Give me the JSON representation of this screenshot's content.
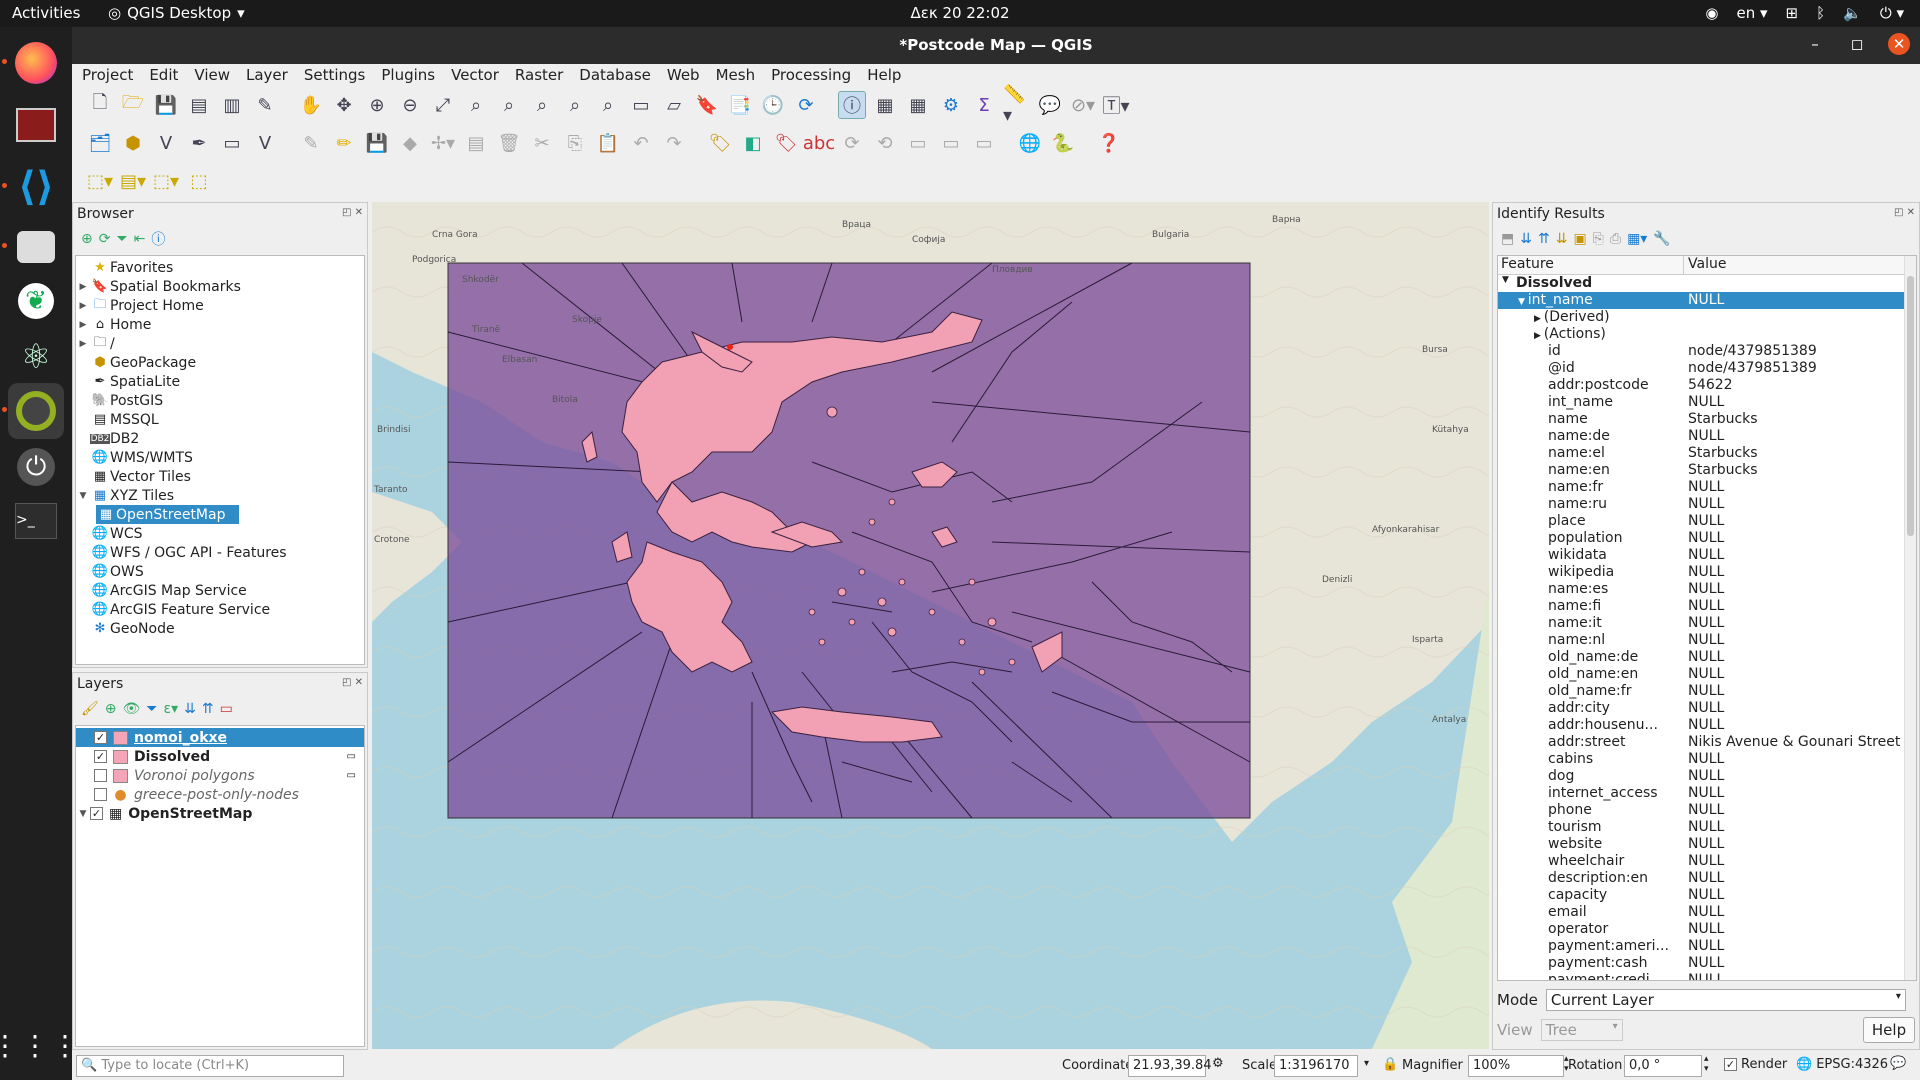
{
  "topbar": {
    "activities": "Activities",
    "app": "QGIS Desktop",
    "clock": "Δεκ 20  22:02",
    "lang": "en"
  },
  "window": {
    "title": "*Postcode Map — QGIS"
  },
  "menu": [
    "Project",
    "Edit",
    "View",
    "Layer",
    "Settings",
    "Plugins",
    "Vector",
    "Raster",
    "Database",
    "Web",
    "Mesh",
    "Processing",
    "Help"
  ],
  "browser": {
    "title": "Browser",
    "items": [
      {
        "label": "Favorites",
        "icon": "star-icon",
        "arrow": ""
      },
      {
        "label": "Spatial Bookmarks",
        "icon": "bookmark-icon",
        "arrow": "▶"
      },
      {
        "label": "Project Home",
        "icon": "folder-icon",
        "arrow": "▶"
      },
      {
        "label": "Home",
        "icon": "home-icon",
        "arrow": "▶"
      },
      {
        "label": "/",
        "icon": "folder-icon",
        "arrow": "▶"
      },
      {
        "label": "GeoPackage",
        "icon": "geopackage-icon",
        "arrow": ""
      },
      {
        "label": "SpatiaLite",
        "icon": "spatialite-icon",
        "arrow": ""
      },
      {
        "label": "PostGIS",
        "icon": "postgis-icon",
        "arrow": ""
      },
      {
        "label": "MSSQL",
        "icon": "mssql-icon",
        "arrow": ""
      },
      {
        "label": "DB2",
        "icon": "db2-icon",
        "arrow": ""
      },
      {
        "label": "WMS/WMTS",
        "icon": "globe-icon",
        "arrow": ""
      },
      {
        "label": "Vector Tiles",
        "icon": "grid-icon",
        "arrow": ""
      },
      {
        "label": "XYZ Tiles",
        "icon": "grid-icon",
        "arrow": "▼"
      },
      {
        "label": "OpenStreetMap",
        "icon": "grid-icon",
        "arrow": "",
        "child": true,
        "selected": true
      },
      {
        "label": "WCS",
        "icon": "globe-icon",
        "arrow": ""
      },
      {
        "label": "WFS / OGC API - Features",
        "icon": "globe-icon",
        "arrow": ""
      },
      {
        "label": "OWS",
        "icon": "globe-icon",
        "arrow": ""
      },
      {
        "label": "ArcGIS Map Service",
        "icon": "globe-icon",
        "arrow": ""
      },
      {
        "label": "ArcGIS Feature Service",
        "icon": "globe-icon",
        "arrow": ""
      },
      {
        "label": "GeoNode",
        "icon": "geonode-icon",
        "arrow": ""
      }
    ]
  },
  "layers": {
    "title": "Layers",
    "items": [
      {
        "label": "nomoi_okxe",
        "checked": true,
        "swatch": "#f4a6b8",
        "bold": true,
        "italic": false,
        "selected": true,
        "underline": true
      },
      {
        "label": "Dissolved",
        "checked": true,
        "swatch": "#f4a6b8",
        "bold": true,
        "italic": false,
        "selected": false
      },
      {
        "label": "Voronoi polygons",
        "checked": false,
        "swatch": "#f4a6b8",
        "bold": false,
        "italic": true,
        "selected": false
      },
      {
        "label": "greece-post-only-nodes",
        "checked": false,
        "swatch": "dot",
        "bold": false,
        "italic": true,
        "selected": false
      },
      {
        "label": "OpenStreetMap",
        "checked": true,
        "swatch": "osm",
        "bold": true,
        "italic": false,
        "selected": false,
        "arrow": "▼"
      }
    ]
  },
  "map": {
    "labels": [
      "Crna Gora",
      "Podgorica",
      "Shkodër",
      "Tiranë",
      "Elbasan",
      "Brindisi",
      "Taranto",
      "Crotone",
      "Bursa",
      "Kütahya",
      "Denizli",
      "Isparta",
      "Antalya",
      "Afyonkarahisar",
      "Bitola",
      "Skopje",
      "Софија",
      "Пловдив",
      "Враца",
      "Βарна",
      "Bulgaria"
    ]
  },
  "identify": {
    "title": "Identify Results",
    "col_feature": "Feature",
    "col_value": "Value",
    "layer": "Dissolved",
    "rows": [
      {
        "f": "int_name",
        "v": "NULL",
        "sel": true,
        "lvl": 1,
        "arr": "▼"
      },
      {
        "f": "(Derived)",
        "v": "",
        "lvl": 2,
        "arr": "▶"
      },
      {
        "f": "(Actions)",
        "v": "",
        "lvl": 2,
        "arr": "▶"
      },
      {
        "f": "id",
        "v": "node/4379851389",
        "lvl": 2
      },
      {
        "f": "@id",
        "v": "node/4379851389",
        "lvl": 2
      },
      {
        "f": "addr:postcode",
        "v": "54622",
        "lvl": 2
      },
      {
        "f": "int_name",
        "v": "NULL",
        "lvl": 2
      },
      {
        "f": "name",
        "v": "Starbucks",
        "lvl": 2
      },
      {
        "f": "name:de",
        "v": "NULL",
        "lvl": 2
      },
      {
        "f": "name:el",
        "v": "Starbucks",
        "lvl": 2
      },
      {
        "f": "name:en",
        "v": "Starbucks",
        "lvl": 2
      },
      {
        "f": "name:fr",
        "v": "NULL",
        "lvl": 2
      },
      {
        "f": "name:ru",
        "v": "NULL",
        "lvl": 2
      },
      {
        "f": "place",
        "v": "NULL",
        "lvl": 2
      },
      {
        "f": "population",
        "v": "NULL",
        "lvl": 2
      },
      {
        "f": "wikidata",
        "v": "NULL",
        "lvl": 2
      },
      {
        "f": "wikipedia",
        "v": "NULL",
        "lvl": 2
      },
      {
        "f": "name:es",
        "v": "NULL",
        "lvl": 2
      },
      {
        "f": "name:fi",
        "v": "NULL",
        "lvl": 2
      },
      {
        "f": "name:it",
        "v": "NULL",
        "lvl": 2
      },
      {
        "f": "name:nl",
        "v": "NULL",
        "lvl": 2
      },
      {
        "f": "old_name:de",
        "v": "NULL",
        "lvl": 2
      },
      {
        "f": "old_name:en",
        "v": "NULL",
        "lvl": 2
      },
      {
        "f": "old_name:fr",
        "v": "NULL",
        "lvl": 2
      },
      {
        "f": "addr:city",
        "v": "NULL",
        "lvl": 2
      },
      {
        "f": "addr:housenu...",
        "v": "NULL",
        "lvl": 2
      },
      {
        "f": "addr:street",
        "v": "Nikis Avenue & Gounari Street",
        "lvl": 2
      },
      {
        "f": "cabins",
        "v": "NULL",
        "lvl": 2
      },
      {
        "f": "dog",
        "v": "NULL",
        "lvl": 2
      },
      {
        "f": "internet_access",
        "v": "NULL",
        "lvl": 2
      },
      {
        "f": "phone",
        "v": "NULL",
        "lvl": 2
      },
      {
        "f": "tourism",
        "v": "NULL",
        "lvl": 2
      },
      {
        "f": "website",
        "v": "NULL",
        "lvl": 2
      },
      {
        "f": "wheelchair",
        "v": "NULL",
        "lvl": 2
      },
      {
        "f": "description:en",
        "v": "NULL",
        "lvl": 2
      },
      {
        "f": "capacity",
        "v": "NULL",
        "lvl": 2
      },
      {
        "f": "email",
        "v": "NULL",
        "lvl": 2
      },
      {
        "f": "operator",
        "v": "NULL",
        "lvl": 2
      },
      {
        "f": "payment:ameri...",
        "v": "NULL",
        "lvl": 2
      },
      {
        "f": "payment:cash",
        "v": "NULL",
        "lvl": 2
      },
      {
        "f": "payment:credi...",
        "v": "NULL",
        "lvl": 2
      }
    ],
    "mode_label": "Mode",
    "mode_value": "Current Layer",
    "view_label": "View",
    "view_value": "Tree",
    "help": "Help"
  },
  "status": {
    "locate_placeholder": "Type to locate (Ctrl+K)",
    "coord_label": "Coordinate",
    "coord": "21.93,39.84",
    "scale_label": "Scale",
    "scale": "1:3196170",
    "magnifier_label": "Magnifier",
    "magnifier": "100%",
    "rotation_label": "Rotation",
    "rotation": "0,0 °",
    "render": "Render",
    "crs": "EPSG:4326"
  }
}
